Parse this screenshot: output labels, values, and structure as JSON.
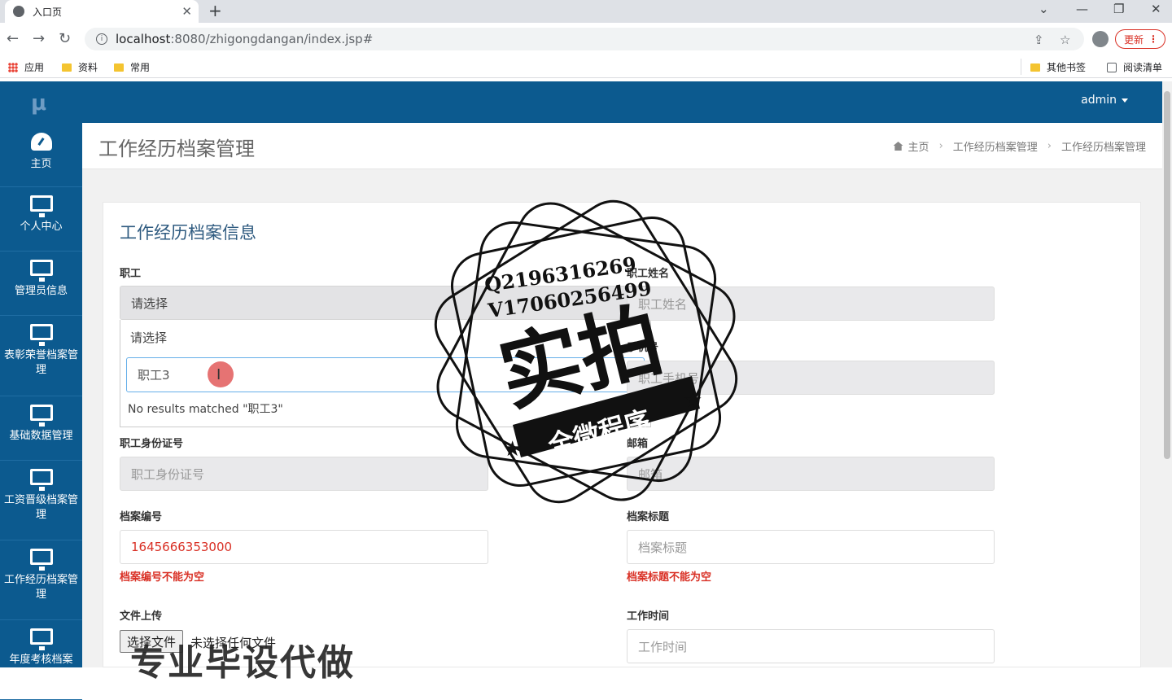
{
  "browser": {
    "tab_title": "入口页",
    "url_host": "localhost",
    "url_path": ":8080/zhigongdangan/index.jsp#",
    "update_label": "更新",
    "bookmarks": [
      "应用",
      "资料",
      "常用"
    ],
    "bookmarks_right": [
      "其他书签",
      "阅读清单"
    ]
  },
  "header": {
    "logo": "μ",
    "user": "admin"
  },
  "sidebar": {
    "items": [
      {
        "label": "主页"
      },
      {
        "label": "个人中心"
      },
      {
        "label": "管理员信息"
      },
      {
        "label": "表彰荣誉档案管理"
      },
      {
        "label": "基础数据管理"
      },
      {
        "label": "工资晋级档案管理"
      },
      {
        "label": "工作经历档案管理"
      },
      {
        "label": "年度考核档案"
      }
    ]
  },
  "page": {
    "title": "工作经历档案管理",
    "breadcrumb": [
      "主页",
      "工作经历档案管理",
      "工作经历档案管理"
    ],
    "panel_title": "工作经历档案信息"
  },
  "form": {
    "employee": {
      "label": "职工",
      "selected": "请选择",
      "option": "请选择",
      "search_value": "职工3",
      "no_results": "No results matched \"职工3\""
    },
    "name": {
      "label": "职工姓名",
      "placeholder": "职工姓名"
    },
    "phone": {
      "label": "手机号",
      "placeholder": "职工手机号"
    },
    "idcard": {
      "label": "职工身份证号",
      "placeholder": "职工身份证号"
    },
    "email": {
      "label": "邮箱",
      "placeholder": "邮箱"
    },
    "archive_no": {
      "label": "档案编号",
      "value": "1645666353000",
      "error": "档案编号不能为空"
    },
    "archive_title": {
      "label": "档案标题",
      "placeholder": "档案标题",
      "error": "档案标题不能为空"
    },
    "file": {
      "label": "文件上传",
      "button": "选择文件",
      "status": "未选择任何文件"
    },
    "work_time": {
      "label": "工作时间",
      "placeholder": "工作时间"
    }
  },
  "watermark": {
    "line1": "Q2196316269",
    "line2": "V17060256499",
    "big": "实拍",
    "ribbon": "全微程序",
    "bottom": "专业毕设代做"
  }
}
